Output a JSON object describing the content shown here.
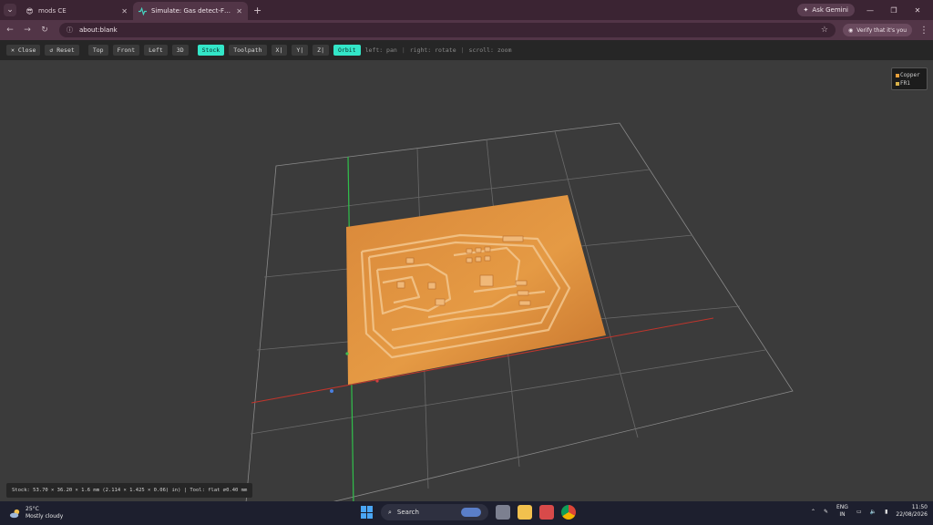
{
  "browser": {
    "tabs": [
      {
        "title": "mods CE",
        "active": false,
        "icon": "sunglasses-emoji-icon"
      },
      {
        "title": "Simulate: Gas detect-F_Cu.png",
        "active": true,
        "icon": "pulse-icon"
      }
    ],
    "ask_gemini": "Ask Gemini",
    "url": "about:blank",
    "verify_label": "Verify that it's you"
  },
  "toolbar": {
    "close": "✕ Close",
    "reset": "↺ Reset",
    "views": [
      "Top",
      "Front",
      "Left",
      "3D"
    ],
    "modes": [
      "Stock",
      "Toolpath"
    ],
    "active_mode": "Stock",
    "axes": [
      "X|",
      "Y|",
      "Z|"
    ],
    "orbit": "Orbit",
    "hints": [
      "left: pan",
      "right: rotate",
      "scroll: zoom"
    ]
  },
  "legend": {
    "items": [
      {
        "label": "Copper",
        "color": "#e8a03a"
      },
      {
        "label": "FR1",
        "color": "#d8b048"
      }
    ]
  },
  "status_text": "Stock: 53.70 × 36.20 × 1.6 mm (2.114 × 1.425 × 0.06) in) | Tool: flat ⌀0.40 mm",
  "taskbar": {
    "weather_temp": "25°C",
    "weather_desc": "Mostly cloudy",
    "search_placeholder": "Search",
    "lang_top": "ENG",
    "lang_bottom": "IN",
    "time": "11:50",
    "date": "22/08/2026"
  }
}
